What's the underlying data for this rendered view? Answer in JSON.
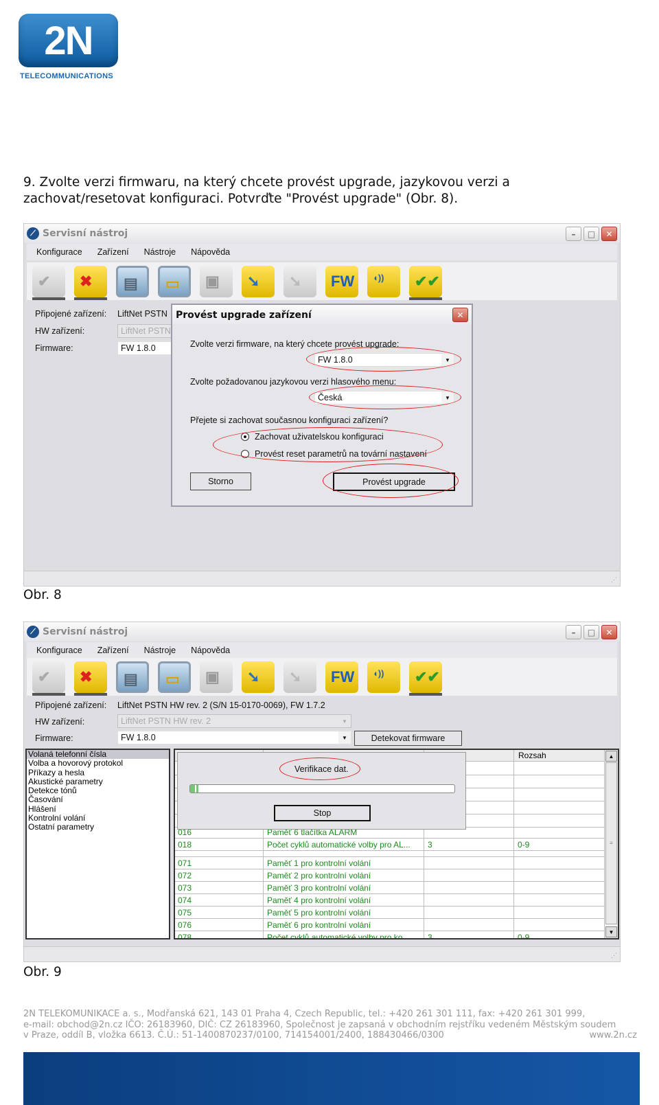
{
  "logo": {
    "mark": "2N",
    "sub": "TELECOMMUNICATIONS"
  },
  "instruction": "9. Zvolte verzi firmwaru, na který chcete provést upgrade, jazykovou verzi a zachovat/resetovat konfiguraci. Potvrďte \"Provést upgrade\" (Obr. 8).",
  "app": {
    "title": "Servisní nástroj",
    "menu": [
      "Konfigurace",
      "Zařízení",
      "Nástroje",
      "Nápověda"
    ],
    "toolbar_icons": [
      "check-icon",
      "disconnect-icon",
      "settings-doc-icon",
      "open-folder-icon",
      "save-icon",
      "upload-icon",
      "download-icon",
      "firmware-upgrade-icon",
      "voice-upgrade-icon",
      "verify-icon"
    ],
    "labels": {
      "connected": "Připojené zařízení:",
      "hw": "HW zařízení:",
      "firmware": "Firmware:"
    }
  },
  "fig8": {
    "connected_value": "LiftNet PSTN",
    "hw_value": "LiftNet PSTN",
    "firmware_value": "FW 1.8.0",
    "dialog": {
      "title": "Provést upgrade zařízení",
      "fw_prompt": "Zvolte verzi firmware, na který chcete provést upgrade:",
      "fw_value": "FW 1.8.0",
      "lang_prompt": "Zvolte požadovanou jazykovou verzi hlasového menu:",
      "lang_value": "Česká",
      "config_prompt": "Přejete si zachovat současnou konfiguraci zařízení?",
      "option_keep": "Zachovat uživatelskou konfiguraci",
      "option_reset": "Provést reset parametrů na tovární nastavení",
      "selected_option": "keep",
      "cancel": "Storno",
      "confirm": "Provést upgrade"
    },
    "caption": "Obr. 8"
  },
  "fig9": {
    "connected_value": "LiftNet PSTN HW rev. 2 (S/N 15-0170-0069), FW 1.7.2",
    "hw_value": "LiftNet PSTN HW rev. 2",
    "firmware_value": "FW 1.8.0",
    "detect_button": "Detekovat firmware",
    "categories": [
      "Volaná telefonní čísla",
      "Volba a hovorový protokol",
      "Příkazy a hesla",
      "Akustické parametry",
      "Detekce tónů",
      "Časování",
      "Hlášení",
      "Kontrolní volání",
      "Ostatní parametry"
    ],
    "selected_category": "Volaná telefonní čísla",
    "grid_header_visible": "Rozsah",
    "rows": [
      {
        "id": "016",
        "name": "Paměť 6 tlačítka ALARM",
        "value": "",
        "range": ""
      },
      {
        "id": "018",
        "name": "Počet cyklů automatické volby pro AL...",
        "value": "3",
        "range": "0-9"
      },
      {
        "id": "",
        "name": "",
        "value": "",
        "range": ""
      },
      {
        "id": "071",
        "name": "Paměť 1 pro kontrolní volání",
        "value": "",
        "range": ""
      },
      {
        "id": "072",
        "name": "Paměť 2 pro kontrolní volání",
        "value": "",
        "range": ""
      },
      {
        "id": "073",
        "name": "Paměť 3 pro kontrolní volání",
        "value": "",
        "range": ""
      },
      {
        "id": "074",
        "name": "Paměť 4 pro kontrolní volání",
        "value": "",
        "range": ""
      },
      {
        "id": "075",
        "name": "Paměť 5 pro kontrolní volání",
        "value": "",
        "range": ""
      },
      {
        "id": "076",
        "name": "Paměť 6 pro kontrolní volání",
        "value": "",
        "range": ""
      },
      {
        "id": "078",
        "name": "Počet cyklů automatické volby pro ko...",
        "value": "3",
        "range": "0-9"
      }
    ],
    "popup": {
      "status": "Verifikace dat.",
      "progress_percent": 3,
      "stop": "Stop"
    },
    "caption": "Obr. 9"
  },
  "footer": [
    "2N TELEKOMUNIKACE a. s., Modřanská 621, 143 01 Praha 4, Czech Republic, tel.: +420 261 301 111, fax: +420 261 301 999,",
    "e-mail: obchod@2n.cz  IČO: 26183960, DIČ: CZ 26183960, Společnost je zapsaná v obchodním rejstříku vedeném Městským soudem",
    "v Praze, oddíl B, vložka 6613. Č.Ú.: 51-1400870237/0100, 714154001/2400,  188430466/0300"
  ],
  "footer_url": "www.2n.cz",
  "colors": {
    "brand_blue": "#0d5a9e",
    "highlight_red": "#dd2222",
    "grid_text_green": "#1e8a1e"
  }
}
